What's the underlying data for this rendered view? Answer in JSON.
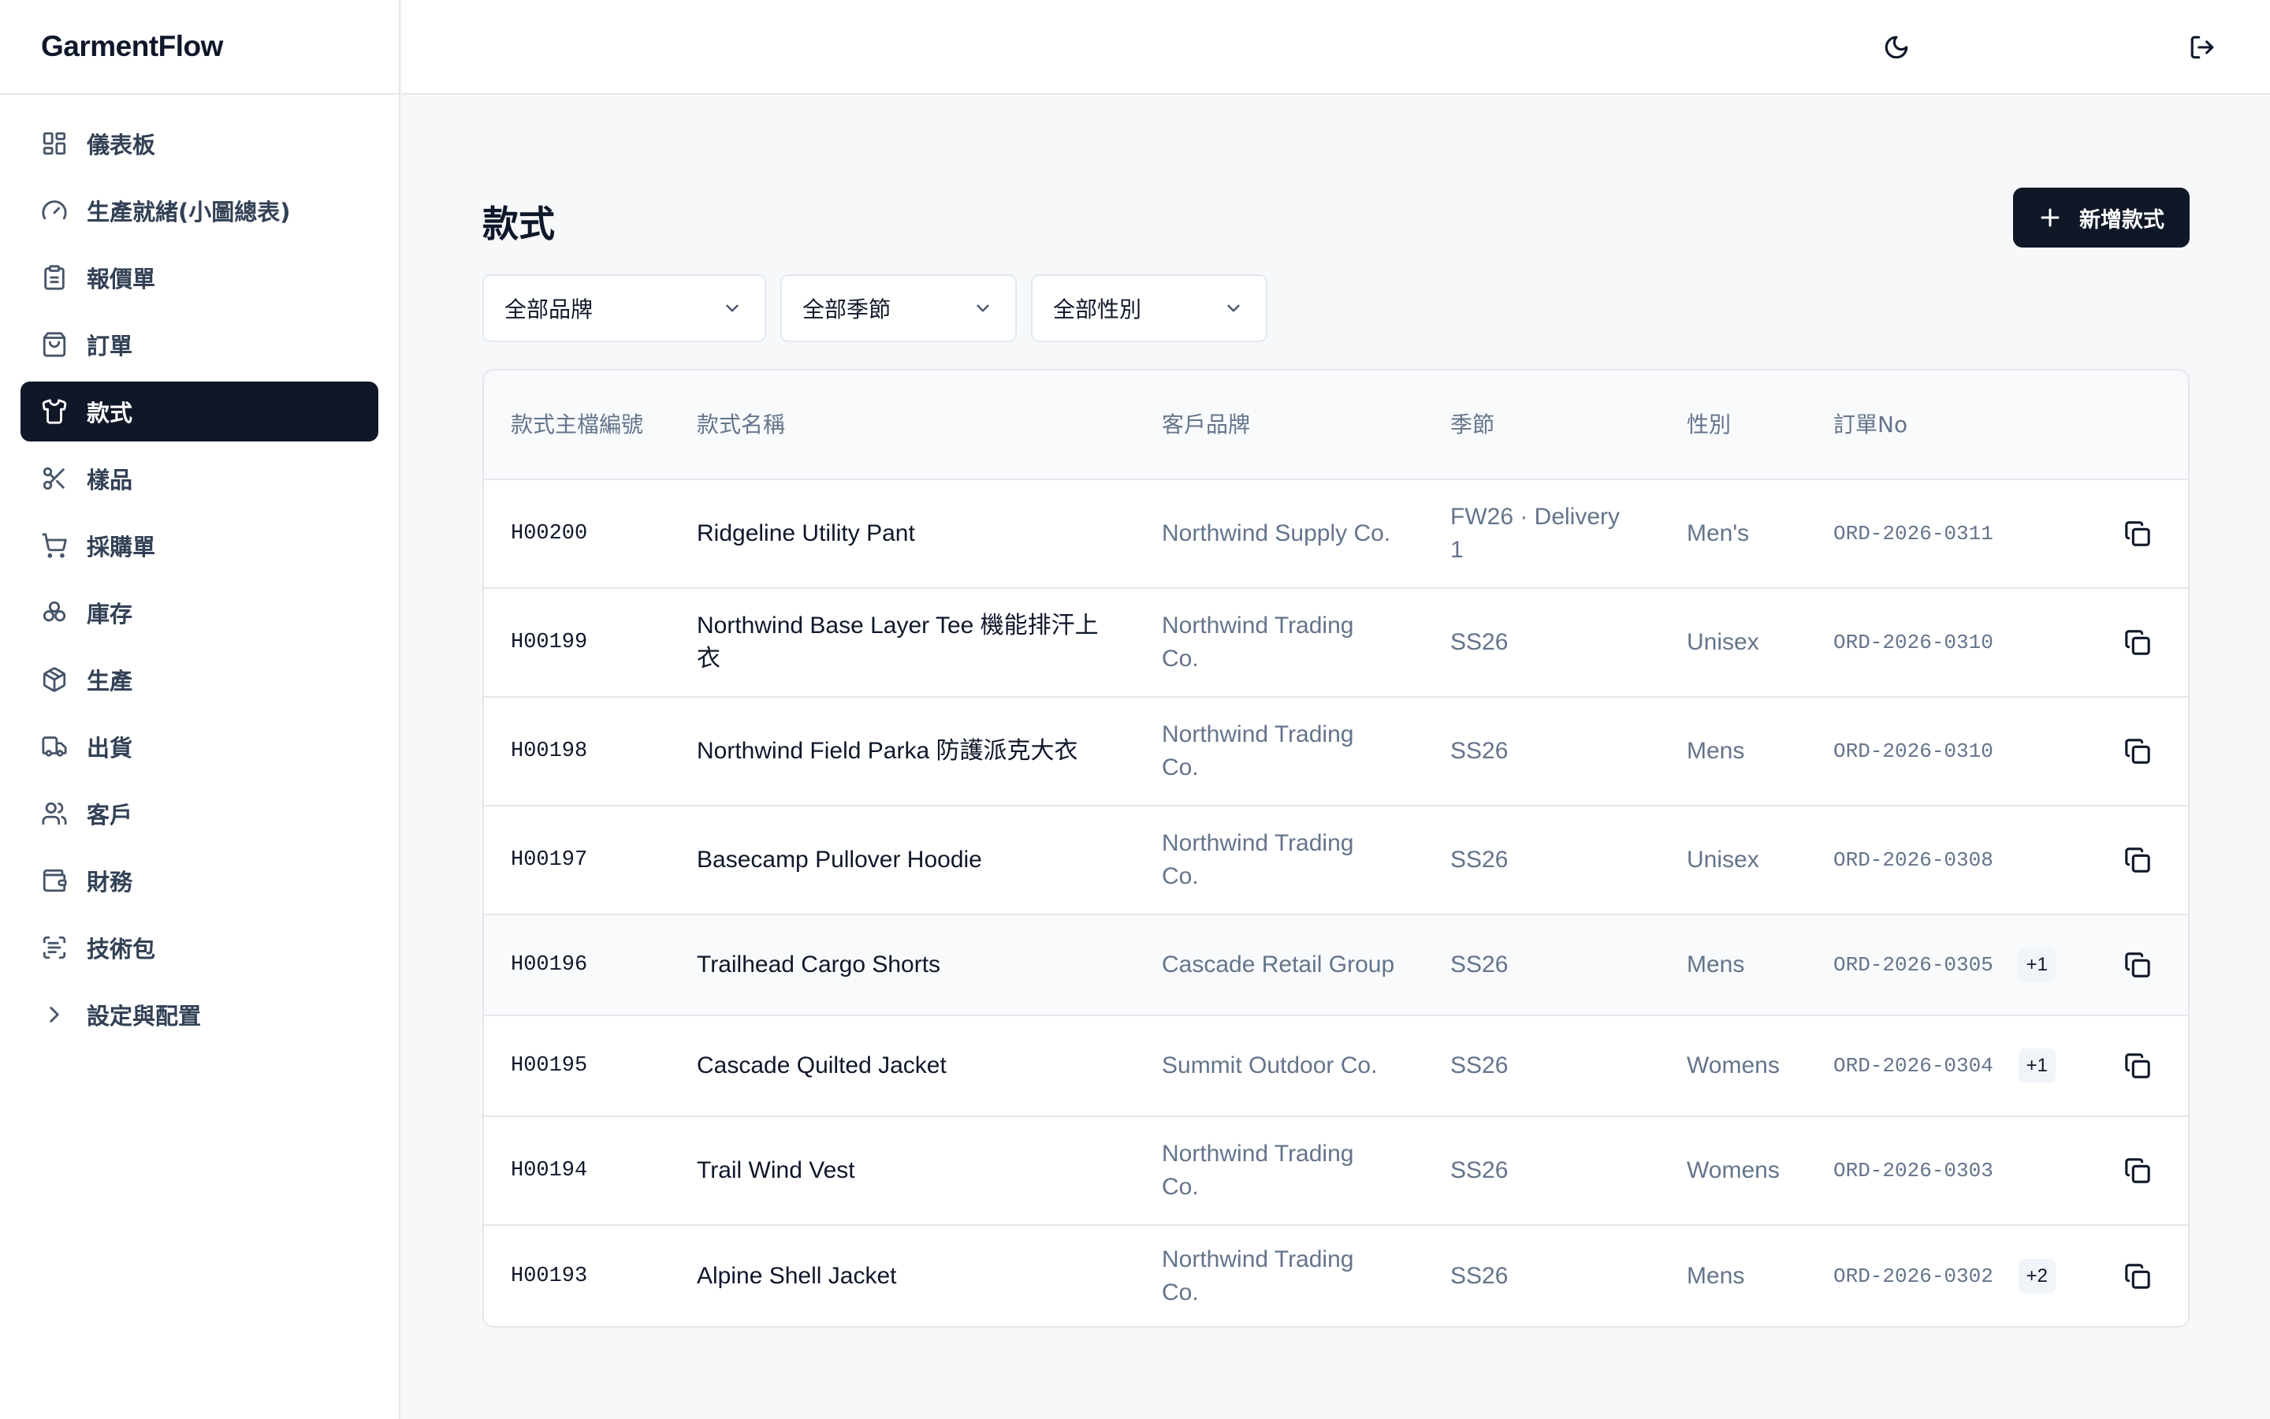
{
  "app": {
    "title": "GarmentFlow"
  },
  "sidebar": {
    "items": [
      {
        "label": "儀表板",
        "icon": "dashboard-icon"
      },
      {
        "label": "生產就緒(小圖總表)",
        "icon": "gauge-icon"
      },
      {
        "label": "報價單",
        "icon": "clipboard-icon"
      },
      {
        "label": "訂單",
        "icon": "shopping-bag-icon"
      },
      {
        "label": "款式",
        "icon": "shirt-icon",
        "active": true
      },
      {
        "label": "樣品",
        "icon": "scissors-icon"
      },
      {
        "label": "採購單",
        "icon": "cart-icon"
      },
      {
        "label": "庫存",
        "icon": "boxes-icon"
      },
      {
        "label": "生產",
        "icon": "package-icon"
      },
      {
        "label": "出貨",
        "icon": "truck-icon"
      },
      {
        "label": "客戶",
        "icon": "users-icon"
      },
      {
        "label": "財務",
        "icon": "wallet-icon"
      },
      {
        "label": "技術包",
        "icon": "scan-text-icon"
      },
      {
        "label": "設定與配置",
        "icon": "chevron-right-icon"
      }
    ]
  },
  "topbar": {
    "theme_icon": "moon-icon",
    "logout_icon": "logout-icon"
  },
  "page": {
    "title": "款式",
    "add_button": "新增款式"
  },
  "filters": {
    "brand": "全部品牌",
    "season": "全部季節",
    "gender": "全部性別"
  },
  "table": {
    "headers": {
      "code": "款式主檔編號",
      "name": "款式名稱",
      "brand": "客戶品牌",
      "season": "季節",
      "gender": "性別",
      "order": "訂單No"
    },
    "rows": [
      {
        "code": "H00200",
        "name": "Ridgeline Utility Pant",
        "brand": "Northwind Supply Co.",
        "season": "FW26 · Delivery 1",
        "gender": "Men's",
        "order": "ORD-2026-0311",
        "extra": ""
      },
      {
        "code": "H00199",
        "name": "Northwind Base Layer Tee 機能排汗上衣",
        "brand": "Northwind Trading Co.",
        "season": "SS26",
        "gender": "Unisex",
        "order": "ORD-2026-0310",
        "extra": ""
      },
      {
        "code": "H00198",
        "name": "Northwind Field Parka 防護派克大衣",
        "brand": "Northwind Trading Co.",
        "season": "SS26",
        "gender": "Mens",
        "order": "ORD-2026-0310",
        "extra": ""
      },
      {
        "code": "H00197",
        "name": "Basecamp Pullover Hoodie",
        "brand": "Northwind Trading Co.",
        "season": "SS26",
        "gender": "Unisex",
        "order": "ORD-2026-0308",
        "extra": ""
      },
      {
        "code": "H00196",
        "name": "Trailhead Cargo Shorts",
        "brand": "Cascade Retail Group",
        "season": "SS26",
        "gender": "Mens",
        "order": "ORD-2026-0305",
        "extra": "+1"
      },
      {
        "code": "H00195",
        "name": "Cascade Quilted Jacket",
        "brand": "Summit Outdoor Co.",
        "season": "SS26",
        "gender": "Womens",
        "order": "ORD-2026-0304",
        "extra": "+1"
      },
      {
        "code": "H00194",
        "name": "Trail Wind Vest",
        "brand": "Northwind Trading Co.",
        "season": "SS26",
        "gender": "Womens",
        "order": "ORD-2026-0303",
        "extra": ""
      },
      {
        "code": "H00193",
        "name": "Alpine Shell Jacket",
        "brand": "Northwind Trading Co.",
        "season": "SS26",
        "gender": "Mens",
        "order": "ORD-2026-0302",
        "extra": "+2"
      }
    ]
  },
  "colors": {
    "primary": "#101828",
    "muted_text": "#64748b",
    "border": "#e5e7eb",
    "page_bg": "#f7f8fa"
  }
}
